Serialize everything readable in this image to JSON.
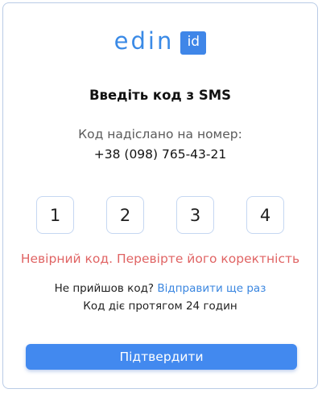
{
  "logo": {
    "word": "edin",
    "badge": "id"
  },
  "title": "Введіть код з SMS",
  "sent_label": "Код надіслано на номер:",
  "phone": "+38 (098) 765-43-21",
  "code_digits": [
    "1",
    "2",
    "3",
    "4"
  ],
  "error_message": "Невірний код. Перевірте його коректність",
  "resend": {
    "question": "Не прийшов код?",
    "link": "Відправити ще раз"
  },
  "validity": "Код діє протягом 24 годин",
  "confirm_button": "Підтвердити",
  "colors": {
    "accent": "#4289ef",
    "error": "#e06464",
    "border": "#c5d7f2"
  }
}
